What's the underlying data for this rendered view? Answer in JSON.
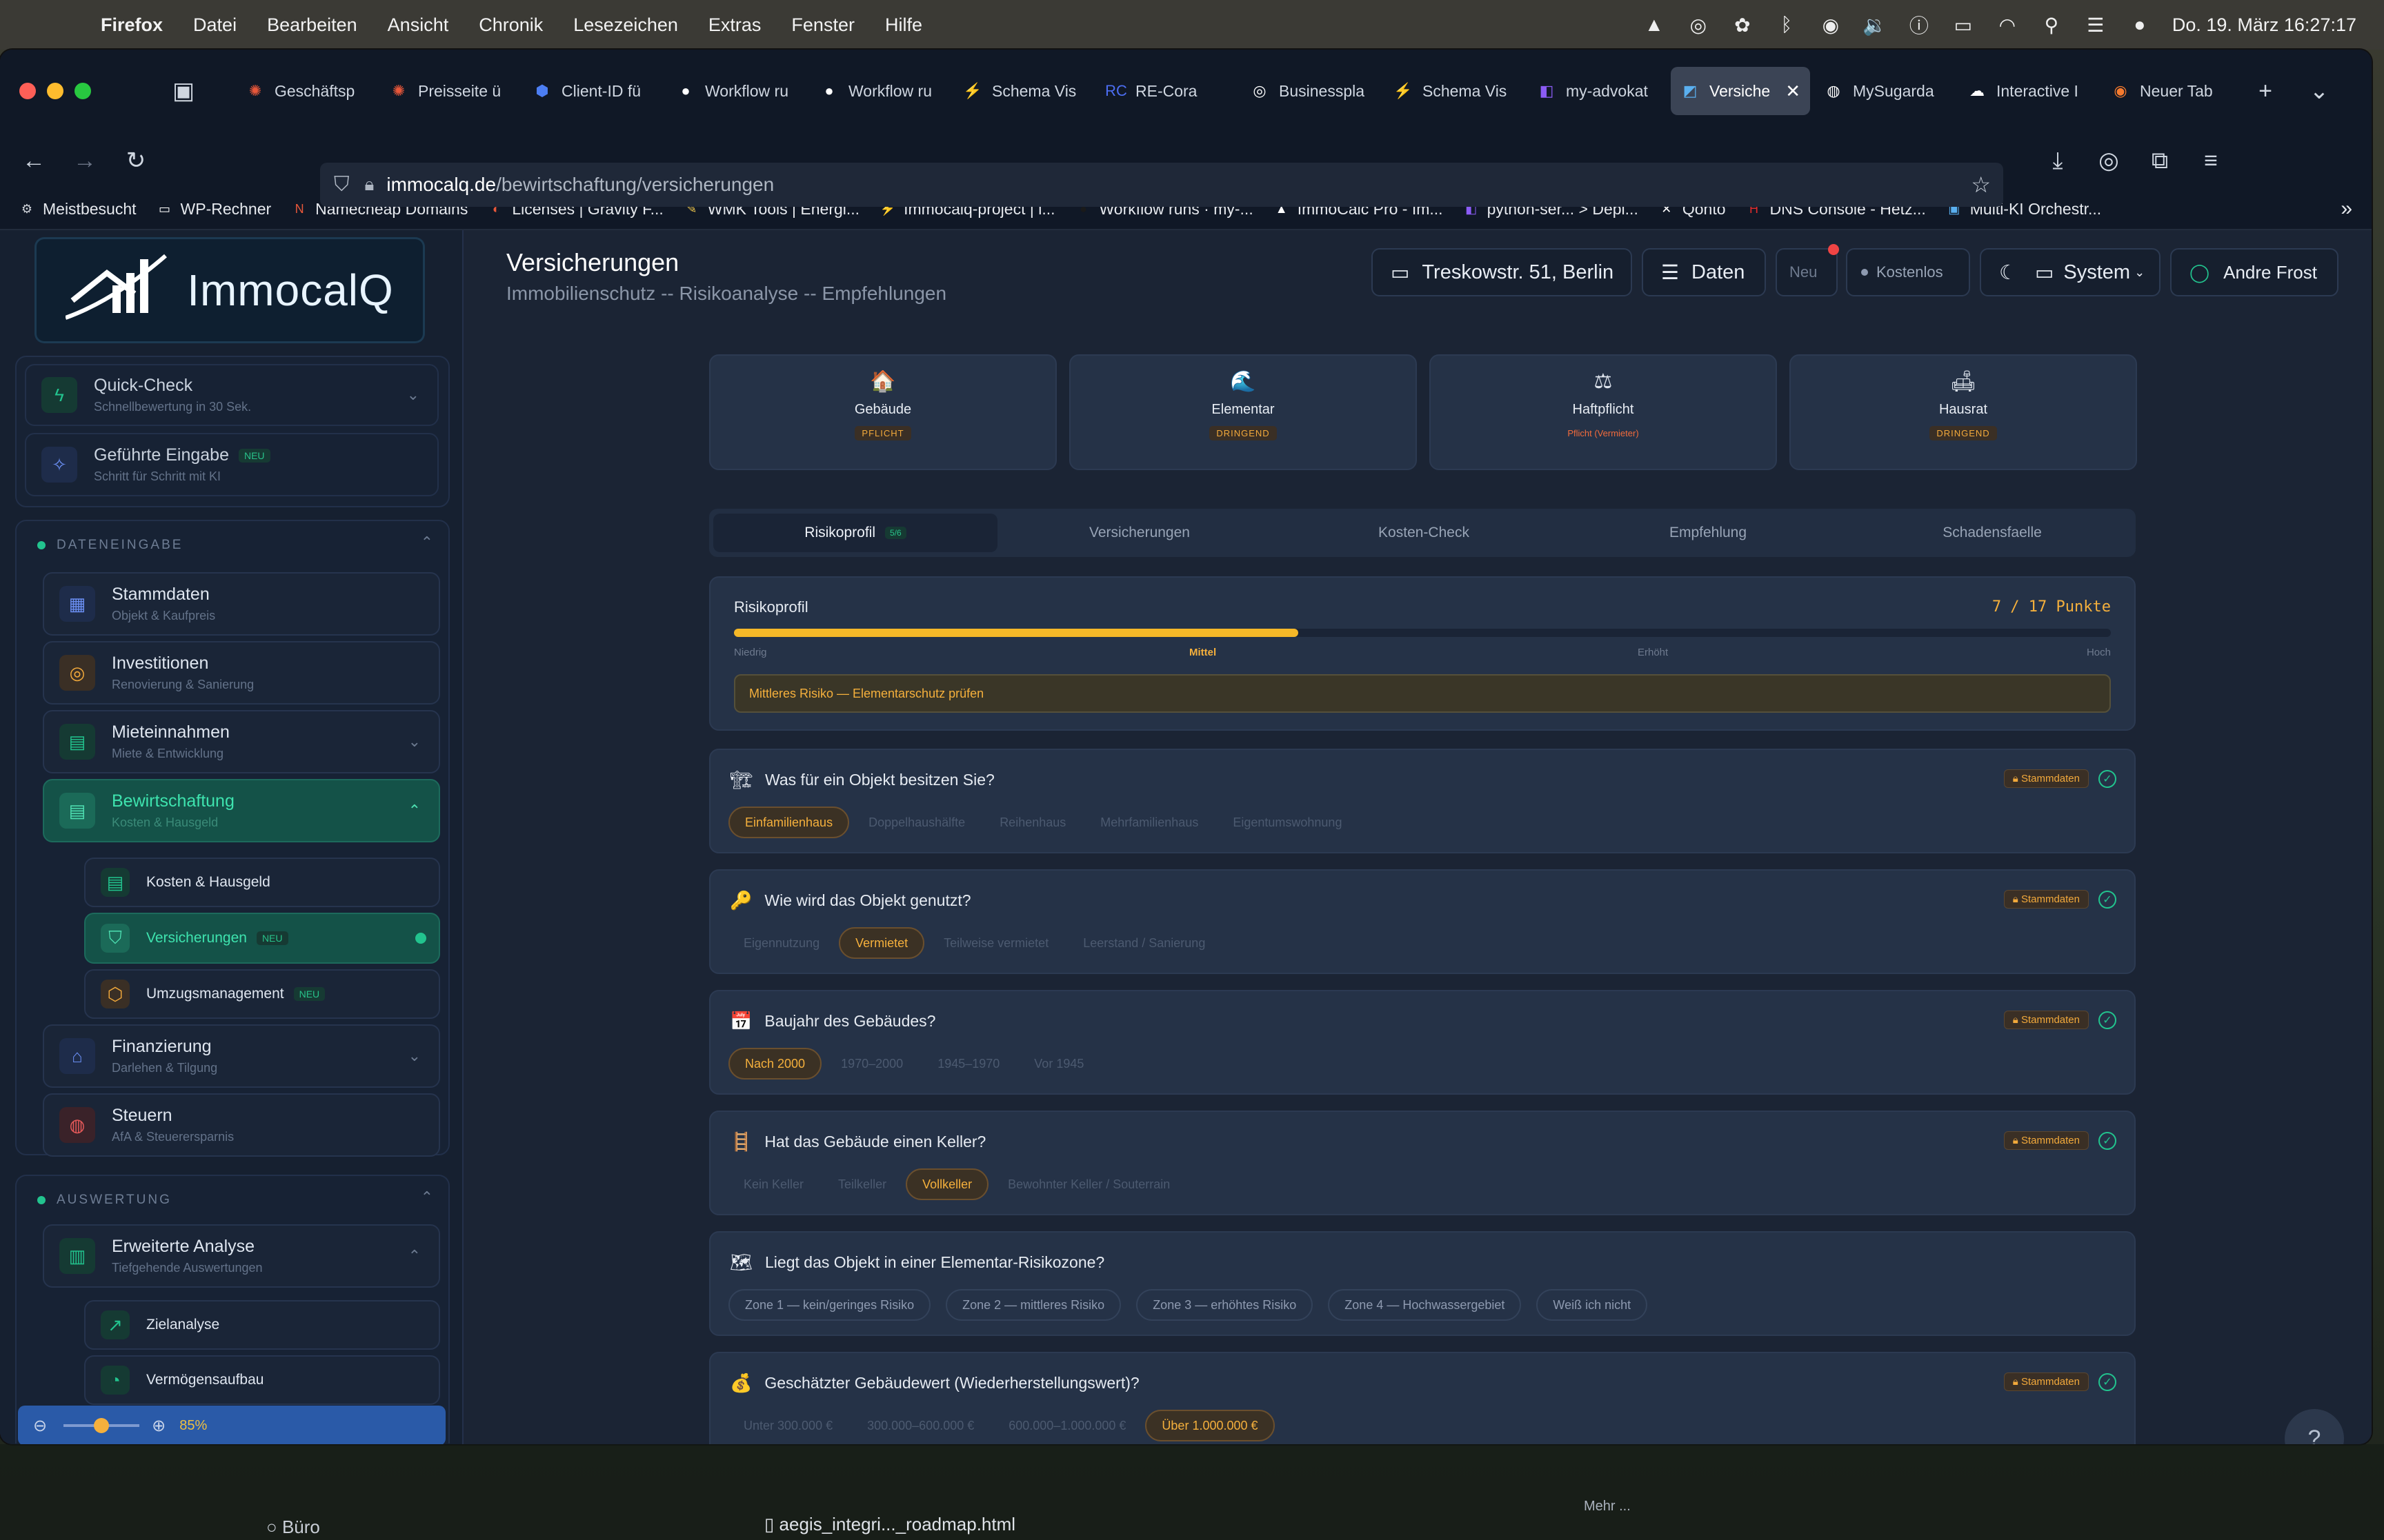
{
  "menubar": {
    "app": "Firefox",
    "items": [
      "Datei",
      "Bearbeiten",
      "Ansicht",
      "Chronik",
      "Lesezeichen",
      "Extras",
      "Fenster",
      "Hilfe"
    ],
    "clock": "Do. 19. März  16:27:17"
  },
  "tabs": [
    {
      "label": "Geschäftsp",
      "fav": "✺",
      "color": "#e8573a"
    },
    {
      "label": "Preisseite ü",
      "fav": "✺",
      "color": "#e8573a"
    },
    {
      "label": "Client-ID fü",
      "fav": "⬢",
      "color": "#4c7ef3"
    },
    {
      "label": "Workflow ru",
      "fav": "●",
      "color": "#ffffff"
    },
    {
      "label": "Workflow ru",
      "fav": "●",
      "color": "#ffffff"
    },
    {
      "label": "Schema Vis",
      "fav": "⚡",
      "color": "#28c28a"
    },
    {
      "label": "RE-Cora",
      "fav": "RC",
      "color": "#4c6ef3"
    },
    {
      "label": "Businesspla",
      "fav": "◎",
      "color": "#ffffff"
    },
    {
      "label": "Schema Vis",
      "fav": "⚡",
      "color": "#28c28a"
    },
    {
      "label": "my-advokat",
      "fav": "◧",
      "color": "#8b5cf6"
    },
    {
      "label": "Versiche",
      "fav": "◩",
      "color": "#5ab0f0",
      "active": true
    },
    {
      "label": "MySugarda",
      "fav": "◍",
      "color": "#ffffff"
    },
    {
      "label": "Interactive I",
      "fav": "☁",
      "color": "#ffffff"
    },
    {
      "label": "Neuer Tab",
      "fav": "◉",
      "color": "#f77b2e"
    }
  ],
  "url": {
    "domain": "immocalq.de",
    "path": "/bewirtschaftung/versicherungen"
  },
  "bookmarks": [
    {
      "label": "Meistbesucht",
      "fav": "⚙",
      "color": "#d0d4da"
    },
    {
      "label": "WP-Rechner",
      "fav": "▭",
      "color": "#ffffff"
    },
    {
      "label": "Namecheap Domains",
      "fav": "N",
      "color": "#e8573a"
    },
    {
      "label": "Licenses | Gravity F...",
      "fav": "◐",
      "color": "#e8573a"
    },
    {
      "label": "WMK Tools | Energi...",
      "fav": "✎",
      "color": "#f2c94c"
    },
    {
      "label": "Immocalq-project | i...",
      "fav": "⚡",
      "color": "#28c28a"
    },
    {
      "label": "Workflow runs · my-...",
      "fav": "●",
      "color": "#1a1a1a"
    },
    {
      "label": "ImmoCalc Pro - Im...",
      "fav": "▲",
      "color": "#ffffff"
    },
    {
      "label": "python-ser... > Depl...",
      "fav": "◧",
      "color": "#8b5cf6"
    },
    {
      "label": "Qonto",
      "fav": "✕",
      "color": "#ffffff"
    },
    {
      "label": "DNS Console - Hetz...",
      "fav": "H",
      "color": "#e02c2c"
    },
    {
      "label": "Multi-KI Orchestr...",
      "fav": "▣",
      "color": "#5ab0f0"
    }
  ],
  "logo": {
    "text": "ImmocalQ"
  },
  "sidebar": {
    "quick": [
      {
        "title": "Quick-Check",
        "sub": "Schnellbewertung in 30 Sek."
      },
      {
        "title": "Geführte Eingabe",
        "badge": "NEU",
        "sub": "Schritt für Schritt mit KI"
      }
    ],
    "section1": "DATENEINGABE",
    "items": [
      {
        "title": "Stammdaten",
        "sub": "Objekt & Kaufpreis"
      },
      {
        "title": "Investitionen",
        "sub": "Renovierung & Sanierung"
      },
      {
        "title": "Mieteinnahmen",
        "sub": "Miete & Entwicklung"
      },
      {
        "title": "Bewirtschaftung",
        "sub": "Kosten & Hausgeld"
      }
    ],
    "sub": [
      {
        "title": "Kosten & Hausgeld"
      },
      {
        "title": "Versicherungen",
        "badge": "NEU"
      },
      {
        "title": "Umzugsmanagement",
        "badge": "NEU"
      }
    ],
    "items2": [
      {
        "title": "Finanzierung",
        "sub": "Darlehen & Tilgung"
      },
      {
        "title": "Steuern",
        "sub": "AfA & Steuerersparnis"
      }
    ],
    "section2": "AUSWERTUNG",
    "analysis": {
      "title": "Erweiterte Analyse",
      "sub": "Tiefgehende Auswertungen"
    },
    "analysis_sub": [
      {
        "title": "Zielanalyse"
      },
      {
        "title": "Vermögensaufbau"
      }
    ],
    "zoom": "85%",
    "zoom_level": 0.5
  },
  "header": {
    "title": "Versicherungen",
    "subtitle": "Immobilienschutz -- Risikoanalyse -- Empfehlungen",
    "address": "Treskowstr. 51, Berlin",
    "daten": "Daten",
    "neu": "Neu",
    "kostenlos": "Kostenlos",
    "system": "System",
    "user": "Andre Frost"
  },
  "categories": [
    {
      "icon": "🏠",
      "label": "Gebäude",
      "badge": "PFLICHT"
    },
    {
      "icon": "🌊",
      "label": "Elementar",
      "badge": "DRINGEND"
    },
    {
      "icon": "⚖",
      "label": "Haftpflicht",
      "badge": "Pflicht (Vermieter)"
    },
    {
      "icon": "🛋",
      "label": "Hausrat",
      "badge": "DRINGEND"
    }
  ],
  "subtabs": [
    {
      "label": "Risikoprofil",
      "badge": "5/6"
    },
    {
      "label": "Versicherungen"
    },
    {
      "label": "Kosten-Check"
    },
    {
      "label": "Empfehlung"
    },
    {
      "label": "Schadensfaelle"
    }
  ],
  "risk": {
    "title": "Risikoprofil",
    "score": "7 / 17 Punkte",
    "progress": 0.41,
    "scale": [
      "Niedrig",
      "Mittel",
      "Erhöht",
      "Hoch"
    ],
    "message": "Mittleres Risiko — Elementarschutz prüfen"
  },
  "questions": [
    {
      "icon": "🏗",
      "q": "Was für ein Objekt besitzen Sie?",
      "tag": "Stammdaten",
      "opts": [
        "Einfamilienhaus",
        "Doppelhaushälfte",
        "Reihenhaus",
        "Mehrfamilienhaus",
        "Eigentumswohnung"
      ],
      "sel": 0
    },
    {
      "icon": "🔑",
      "q": "Wie wird das Objekt genutzt?",
      "tag": "Stammdaten",
      "opts": [
        "Eigennutzung",
        "Vermietet",
        "Teilweise vermietet",
        "Leerstand / Sanierung"
      ],
      "sel": 1
    },
    {
      "icon": "📅",
      "q": "Baujahr des Gebäudes?",
      "tag": "Stammdaten",
      "opts": [
        "Nach 2000",
        "1970–2000",
        "1945–1970",
        "Vor 1945"
      ],
      "sel": 0
    },
    {
      "icon": "🪜",
      "q": "Hat das Gebäude einen Keller?",
      "tag": "Stammdaten",
      "opts": [
        "Kein Keller",
        "Teilkeller",
        "Vollkeller",
        "Bewohnter Keller / Souterrain"
      ],
      "sel": 2
    },
    {
      "icon": "🗺",
      "q": "Liegt das Objekt in einer Elementar-Risikozone?",
      "opts": [
        "Zone 1 — kein/geringes Risiko",
        "Zone 2 — mittleres Risiko",
        "Zone 3 — erhöhtes Risiko",
        "Zone 4 — Hochwassergebiet",
        "Weiß ich nicht"
      ],
      "sel": -1
    },
    {
      "icon": "💰",
      "q": "Geschätzter Gebäudewert (Wiederherstellungswert)?",
      "tag": "Stammdaten",
      "opts": [
        "Unter 300.000 €",
        "300.000–600.000 €",
        "600.000–1.000.000 €",
        "Über 1.000.000 €"
      ],
      "sel": 3
    }
  ],
  "help": "?",
  "dock": {
    "bureau": "Büro",
    "file": "aegis_integri..._roadmap.html",
    "more": "Mehr ..."
  },
  "colors": {
    "accent": "#f5b03c",
    "green": "#22c38e",
    "bg": "#1b2434",
    "card": "#253247"
  }
}
